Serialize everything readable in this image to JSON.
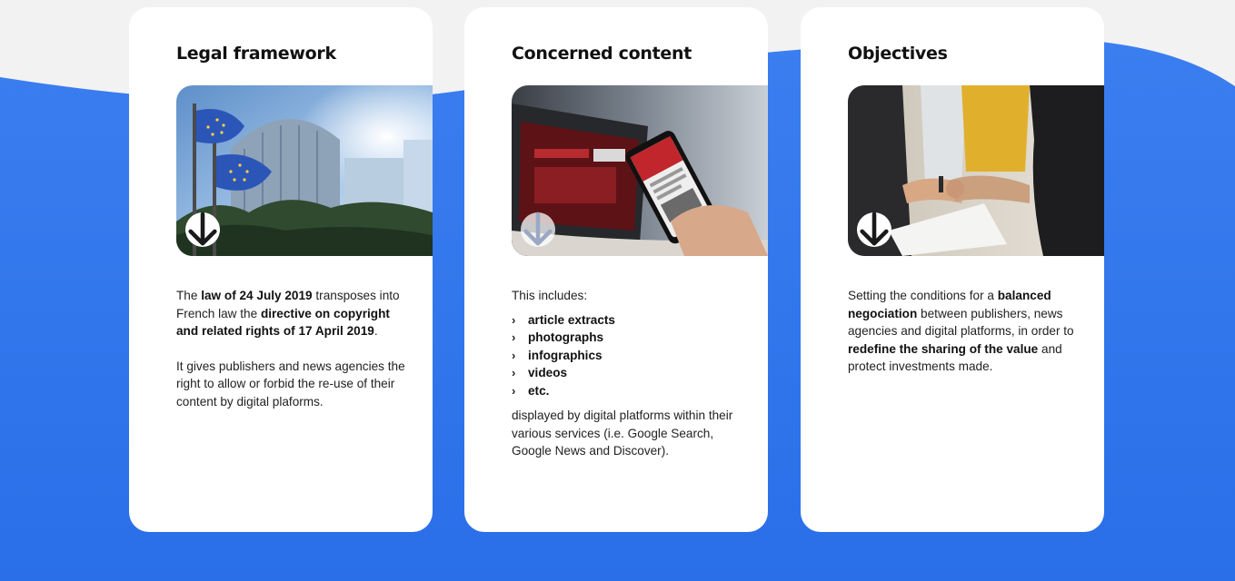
{
  "colors": {
    "accent": "#2f73ec",
    "background": "#f2f2f2",
    "card": "#ffffff"
  },
  "cards": [
    {
      "title": "Legal framework",
      "image_icon": "eu-flags-parliament-photo",
      "paragraph1": {
        "p1": "The ",
        "b1": "law of 24 July 2019",
        "p2": " transposes into French law the ",
        "b2": "directive on copyright and related rights of 17 April 2019",
        "p3": "."
      },
      "paragraph2": "It gives publishers and news agencies the right to allow or forbid the re-use of their content by digital plaforms."
    },
    {
      "title": "Concerned content",
      "image_icon": "phone-laptop-news-photo",
      "intro": "This includes:",
      "items": [
        "article extracts",
        "photographs",
        "infographics",
        "videos",
        "etc."
      ],
      "outro": "displayed by digital platforms within their various services (i.e. Google Search, Google News and Discover)."
    },
    {
      "title": "Objectives",
      "image_icon": "handshake-photo",
      "paragraph": {
        "p1": "Setting the conditions for a ",
        "b1": "balanced negociation",
        "p2": " between publishers, news agencies and digital platforms, in order to ",
        "b2": "redefine the sharing of the value",
        "p3": " and protect investments made."
      }
    }
  ]
}
